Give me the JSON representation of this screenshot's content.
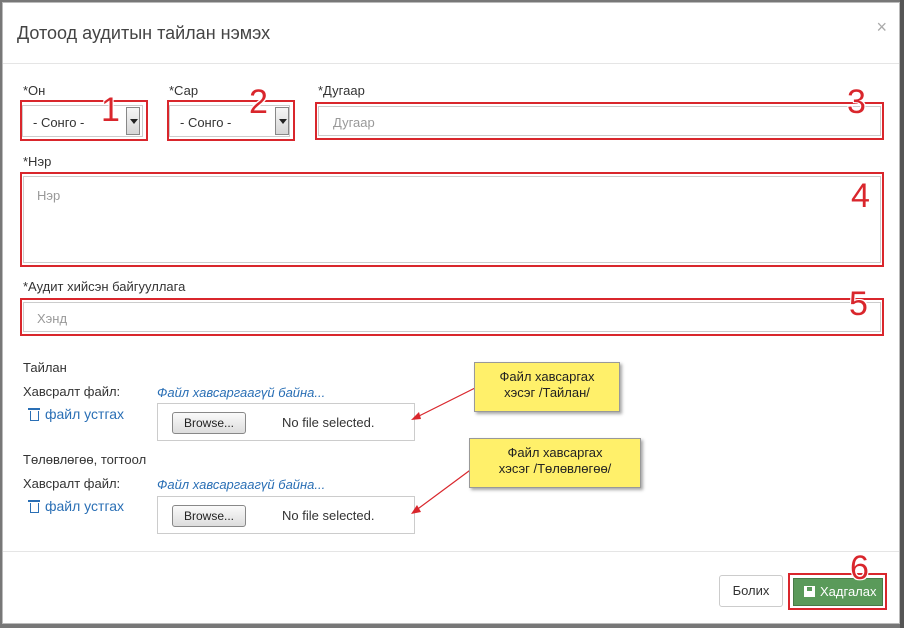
{
  "modal": {
    "title": "Дотоод аудитын тайлан нэмэх",
    "close": "×"
  },
  "fields": {
    "year": {
      "label": "*Он",
      "value": "- Сонго -"
    },
    "month": {
      "label": "*Сар",
      "value": "- Сонго -"
    },
    "number": {
      "label": "*Дугаар",
      "placeholder": "Дугаар"
    },
    "name": {
      "label": "*Нэр",
      "placeholder": "Нэр"
    },
    "org": {
      "label": "*Аудит хийсэн байгууллага",
      "placeholder": "Хэнд"
    }
  },
  "report": {
    "section": "Тайлан",
    "attach_label": "Хавсралт файл:",
    "no_file_link": "Файл хавсаргаагүй байна...",
    "delete_link": "файл устгах",
    "browse": "Browse...",
    "no_file": "No file selected."
  },
  "plan": {
    "section": "Төлөвлөгөө, тогтоол",
    "attach_label": "Хавсралт файл:",
    "no_file_link": "Файл хавсаргаагүй байна...",
    "delete_link": "файл устгах",
    "browse": "Browse...",
    "no_file": "No file selected."
  },
  "notes": {
    "report": [
      "Файл хавсаргах",
      "хэсэг /Тайлан/"
    ],
    "plan": [
      "Файл хавсаргах",
      "хэсэг /Төлөвлөгөө/"
    ]
  },
  "numbers": [
    "1",
    "2",
    "3",
    "4",
    "5",
    "6"
  ],
  "buttons": {
    "cancel": "Болих",
    "save": "Хадгалах"
  },
  "colors": {
    "highlight": "#d9262c",
    "save": "#5a9a5a",
    "link": "#2a6fb5",
    "note": "#fff06a"
  }
}
